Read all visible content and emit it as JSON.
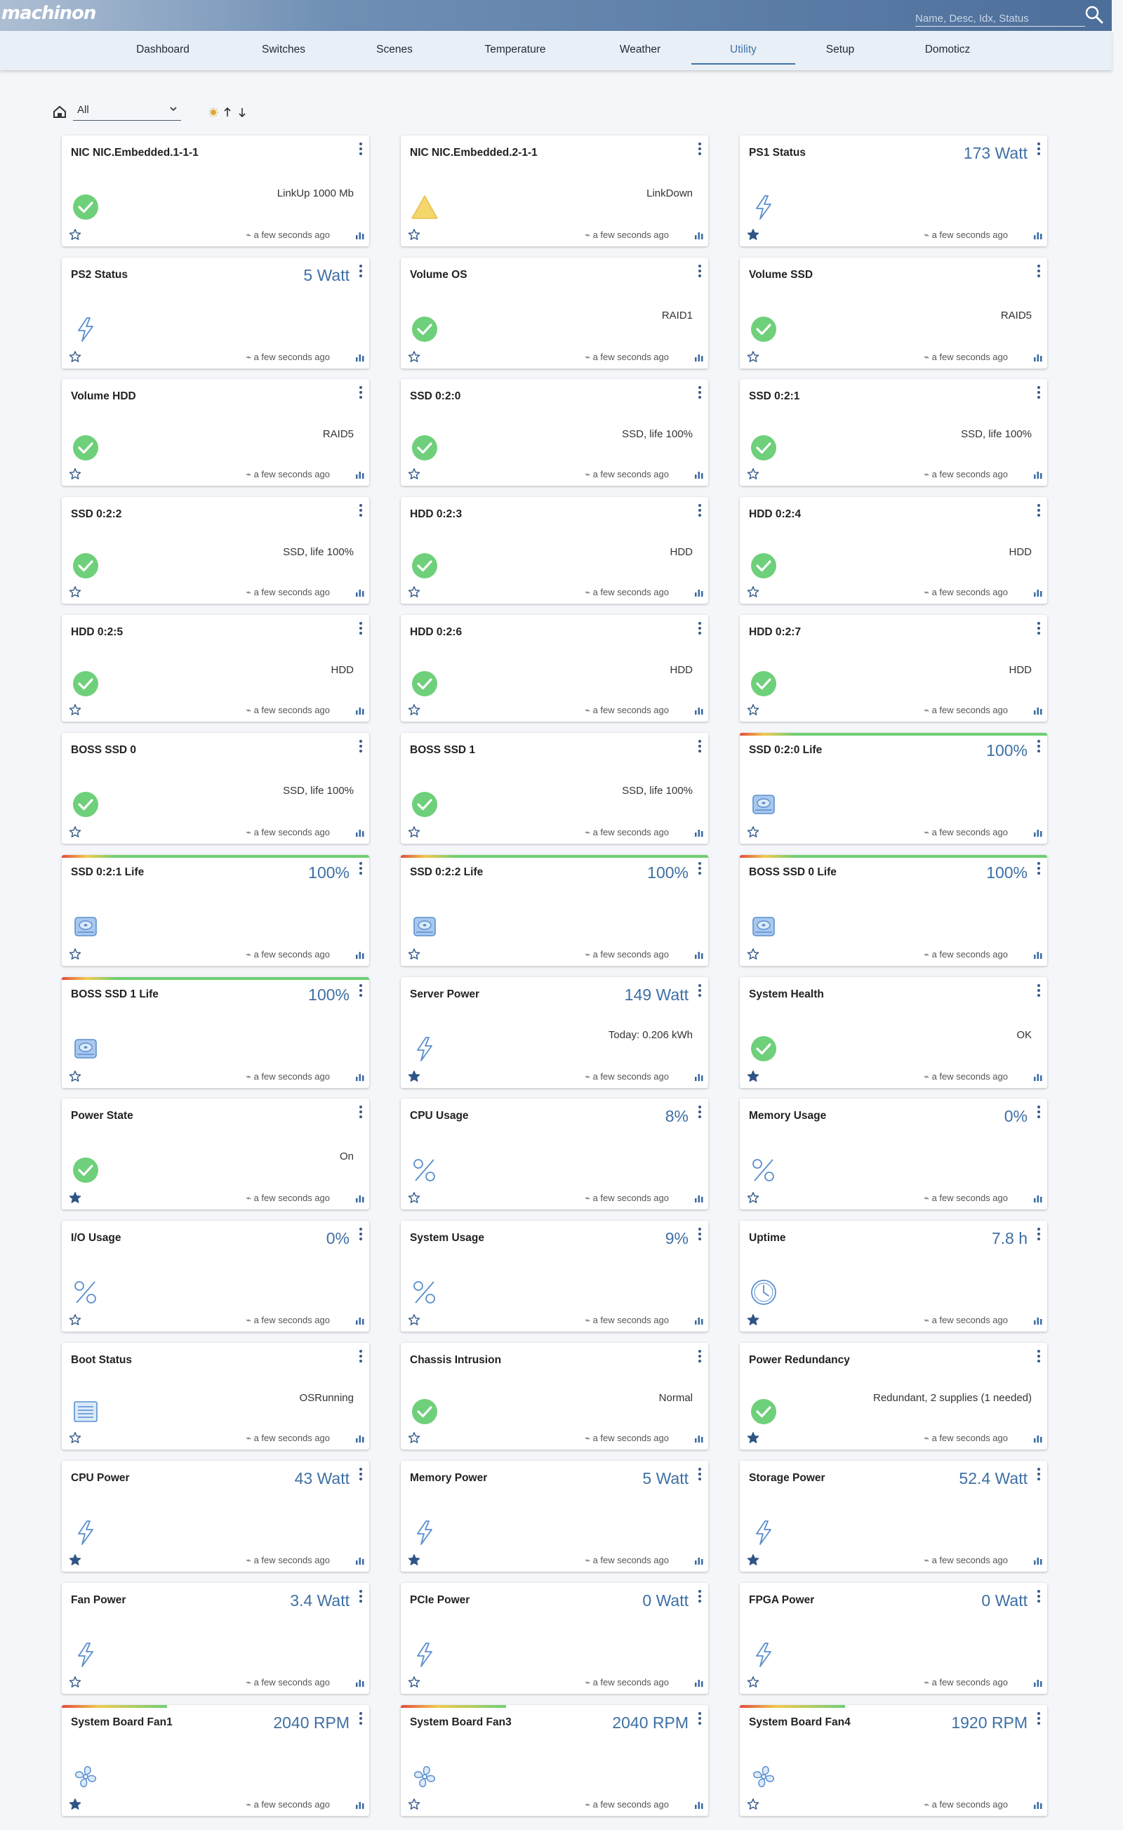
{
  "app": {
    "logo": "machinon"
  },
  "search": {
    "placeholder": "Name, Desc, Idx, Status"
  },
  "nav": [
    {
      "label": "Dashboard",
      "active": false
    },
    {
      "label": "Switches",
      "active": false
    },
    {
      "label": "Scenes",
      "active": false
    },
    {
      "label": "Temperature",
      "active": false
    },
    {
      "label": "Weather",
      "active": false
    },
    {
      "label": "Utility",
      "active": true
    },
    {
      "label": "Setup",
      "active": false
    },
    {
      "label": "Domoticz",
      "active": false
    }
  ],
  "filter": {
    "room": "All"
  },
  "colors": {
    "accent": "#3e70a4",
    "ok_green": "#6ed07a",
    "warn_yellow": "#f5d66b",
    "icon_blue": "#5a8fcf"
  },
  "cards": [
    {
      "name": "NIC NIC.Embedded.1-1-1",
      "value": "",
      "status": "LinkUp 1000 Mb",
      "icon": "check-circle-icon",
      "favorite": false,
      "updated": "a few seconds ago",
      "bar": false
    },
    {
      "name": "NIC NIC.Embedded.2-1-1",
      "value": "",
      "status": "LinkDown",
      "icon": "warning-icon",
      "favorite": false,
      "updated": "a few seconds ago",
      "bar": false
    },
    {
      "name": "PS1 Status",
      "value": "173 Watt",
      "status": "",
      "icon": "lightning-icon",
      "favorite": true,
      "updated": "a few seconds ago",
      "bar": false
    },
    {
      "name": "PS2 Status",
      "value": "5 Watt",
      "status": "",
      "icon": "lightning-icon",
      "favorite": false,
      "updated": "a few seconds ago",
      "bar": false
    },
    {
      "name": "Volume OS",
      "value": "",
      "status": "RAID1",
      "icon": "check-circle-icon",
      "favorite": false,
      "updated": "a few seconds ago",
      "bar": false
    },
    {
      "name": "Volume SSD",
      "value": "",
      "status": "RAID5",
      "icon": "check-circle-icon",
      "favorite": false,
      "updated": "a few seconds ago",
      "bar": false
    },
    {
      "name": "Volume HDD",
      "value": "",
      "status": "RAID5",
      "icon": "check-circle-icon",
      "favorite": false,
      "updated": "a few seconds ago",
      "bar": false
    },
    {
      "name": "SSD 0:2:0",
      "value": "",
      "status": "SSD, life 100%",
      "icon": "check-circle-icon",
      "favorite": false,
      "updated": "a few seconds ago",
      "bar": false
    },
    {
      "name": "SSD 0:2:1",
      "value": "",
      "status": "SSD, life 100%",
      "icon": "check-circle-icon",
      "favorite": false,
      "updated": "a few seconds ago",
      "bar": false
    },
    {
      "name": "SSD 0:2:2",
      "value": "",
      "status": "SSD, life 100%",
      "icon": "check-circle-icon",
      "favorite": false,
      "updated": "a few seconds ago",
      "bar": false
    },
    {
      "name": "HDD 0:2:3",
      "value": "",
      "status": "HDD",
      "icon": "check-circle-icon",
      "favorite": false,
      "updated": "a few seconds ago",
      "bar": false
    },
    {
      "name": "HDD 0:2:4",
      "value": "",
      "status": "HDD",
      "icon": "check-circle-icon",
      "favorite": false,
      "updated": "a few seconds ago",
      "bar": false
    },
    {
      "name": "HDD 0:2:5",
      "value": "",
      "status": "HDD",
      "icon": "check-circle-icon",
      "favorite": false,
      "updated": "a few seconds ago",
      "bar": false
    },
    {
      "name": "HDD 0:2:6",
      "value": "",
      "status": "HDD",
      "icon": "check-circle-icon",
      "favorite": false,
      "updated": "a few seconds ago",
      "bar": false
    },
    {
      "name": "HDD 0:2:7",
      "value": "",
      "status": "HDD",
      "icon": "check-circle-icon",
      "favorite": false,
      "updated": "a few seconds ago",
      "bar": false
    },
    {
      "name": "BOSS SSD 0",
      "value": "",
      "status": "SSD, life 100%",
      "icon": "check-circle-icon",
      "favorite": false,
      "updated": "a few seconds ago",
      "bar": false
    },
    {
      "name": "BOSS SSD 1",
      "value": "",
      "status": "SSD, life 100%",
      "icon": "check-circle-icon",
      "favorite": false,
      "updated": "a few seconds ago",
      "bar": false
    },
    {
      "name": "SSD 0:2:0 Life",
      "value": "100%",
      "status": "",
      "icon": "disk-icon",
      "favorite": false,
      "updated": "a few seconds ago",
      "bar": true
    },
    {
      "name": "SSD 0:2:1 Life",
      "value": "100%",
      "status": "",
      "icon": "disk-icon",
      "favorite": false,
      "updated": "a few seconds ago",
      "bar": true
    },
    {
      "name": "SSD 0:2:2 Life",
      "value": "100%",
      "status": "",
      "icon": "disk-icon",
      "favorite": false,
      "updated": "a few seconds ago",
      "bar": true
    },
    {
      "name": "BOSS SSD 0 Life",
      "value": "100%",
      "status": "",
      "icon": "disk-icon",
      "favorite": false,
      "updated": "a few seconds ago",
      "bar": true
    },
    {
      "name": "BOSS SSD 1 Life",
      "value": "100%",
      "status": "",
      "icon": "disk-icon",
      "favorite": false,
      "updated": "a few seconds ago",
      "bar": true
    },
    {
      "name": "Server Power",
      "value": "149 Watt",
      "status": "Today: 0.206 kWh",
      "icon": "lightning-icon",
      "favorite": true,
      "updated": "a few seconds ago",
      "bar": false
    },
    {
      "name": "System Health",
      "value": "",
      "status": "OK",
      "icon": "check-circle-icon",
      "favorite": true,
      "updated": "a few seconds ago",
      "bar": false
    },
    {
      "name": "Power State",
      "value": "",
      "status": "On",
      "icon": "check-circle-icon",
      "favorite": true,
      "updated": "a few seconds ago",
      "bar": false
    },
    {
      "name": "CPU Usage",
      "value": "8%",
      "status": "",
      "icon": "percent-icon",
      "favorite": false,
      "updated": "a few seconds ago",
      "bar": false
    },
    {
      "name": "Memory Usage",
      "value": "0%",
      "status": "",
      "icon": "percent-icon",
      "favorite": false,
      "updated": "a few seconds ago",
      "bar": false
    },
    {
      "name": "I/O Usage",
      "value": "0%",
      "status": "",
      "icon": "percent-icon",
      "favorite": false,
      "updated": "a few seconds ago",
      "bar": false
    },
    {
      "name": "System Usage",
      "value": "9%",
      "status": "",
      "icon": "percent-icon",
      "favorite": false,
      "updated": "a few seconds ago",
      "bar": false
    },
    {
      "name": "Uptime",
      "value": "7.8 h",
      "status": "",
      "icon": "clock-icon",
      "favorite": true,
      "updated": "a few seconds ago",
      "bar": false
    },
    {
      "name": "Boot Status",
      "value": "",
      "status": "OSRunning",
      "icon": "text-document-icon",
      "favorite": false,
      "updated": "a few seconds ago",
      "bar": false
    },
    {
      "name": "Chassis Intrusion",
      "value": "",
      "status": "Normal",
      "icon": "check-circle-icon",
      "favorite": false,
      "updated": "a few seconds ago",
      "bar": false
    },
    {
      "name": "Power Redundancy",
      "value": "",
      "status": "Redundant, 2 supplies (1 needed)",
      "icon": "check-circle-icon",
      "favorite": true,
      "updated": "a few seconds ago",
      "bar": false
    },
    {
      "name": "CPU Power",
      "value": "43 Watt",
      "status": "",
      "icon": "lightning-icon",
      "favorite": true,
      "updated": "a few seconds ago",
      "bar": false
    },
    {
      "name": "Memory Power",
      "value": "5 Watt",
      "status": "",
      "icon": "lightning-icon",
      "favorite": true,
      "updated": "a few seconds ago",
      "bar": false
    },
    {
      "name": "Storage Power",
      "value": "52.4 Watt",
      "status": "",
      "icon": "lightning-icon",
      "favorite": true,
      "updated": "a few seconds ago",
      "bar": false
    },
    {
      "name": "Fan Power",
      "value": "3.4 Watt",
      "status": "",
      "icon": "lightning-icon",
      "favorite": false,
      "updated": "a few seconds ago",
      "bar": false
    },
    {
      "name": "PCIe Power",
      "value": "0 Watt",
      "status": "",
      "icon": "lightning-icon",
      "favorite": false,
      "updated": "a few seconds ago",
      "bar": false
    },
    {
      "name": "FPGA Power",
      "value": "0 Watt",
      "status": "",
      "icon": "lightning-icon",
      "favorite": false,
      "updated": "a few seconds ago",
      "bar": false
    },
    {
      "name": "System Board Fan1",
      "value": "2040 RPM",
      "status": "",
      "icon": "fan-icon",
      "favorite": true,
      "updated": "a few seconds ago",
      "bar": true
    },
    {
      "name": "System Board Fan3",
      "value": "2040 RPM",
      "status": "",
      "icon": "fan-icon",
      "favorite": false,
      "updated": "a few seconds ago",
      "bar": true
    },
    {
      "name": "System Board Fan4",
      "value": "1920 RPM",
      "status": "",
      "icon": "fan-icon",
      "favorite": false,
      "updated": "a few seconds ago",
      "bar": true
    }
  ]
}
